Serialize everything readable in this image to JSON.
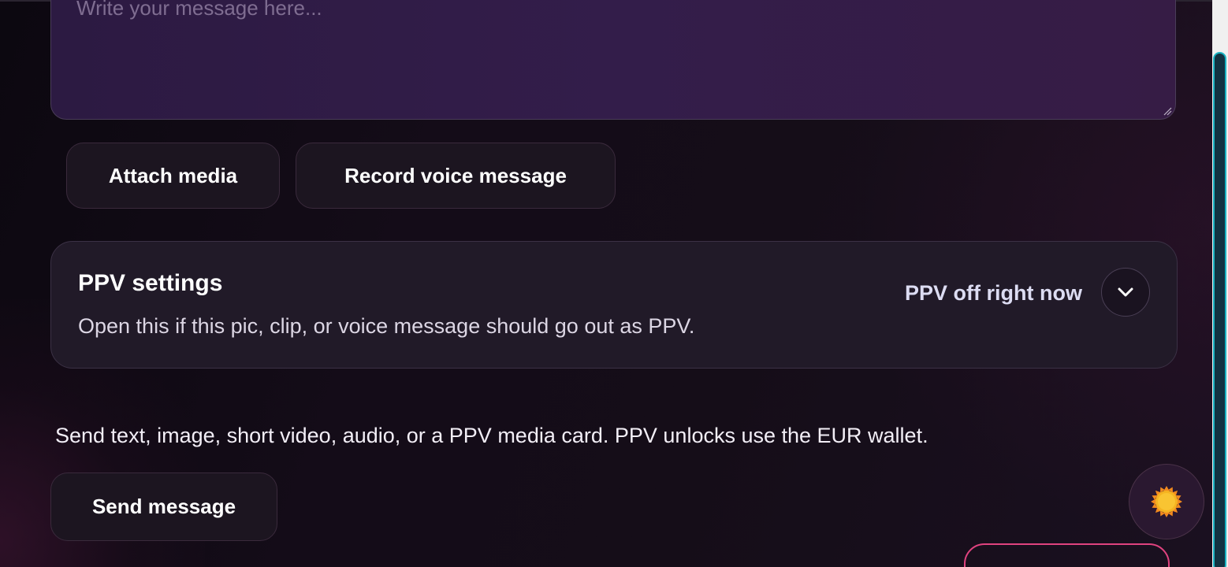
{
  "composer": {
    "message_placeholder": "Write your message here...",
    "attach_label": "Attach media",
    "record_label": "Record voice message"
  },
  "ppv": {
    "title": "PPV settings",
    "description": "Open this if this pic, clip, or voice message should go out as PPV.",
    "status": "PPV off right now",
    "expanded": false
  },
  "footer": {
    "helper_text": "Send text, image, short video, audio, or a PPV media card. PPV unlocks use the EUR wallet.",
    "send_label": "Send message"
  },
  "icons": {
    "ppv_toggle": "chevron-down-icon",
    "theme_toggle": "sun-icon"
  },
  "colors": {
    "accent_pink": "#e0437f",
    "scrollbar_accent": "#19b3c2",
    "sun": "#f5b321"
  }
}
